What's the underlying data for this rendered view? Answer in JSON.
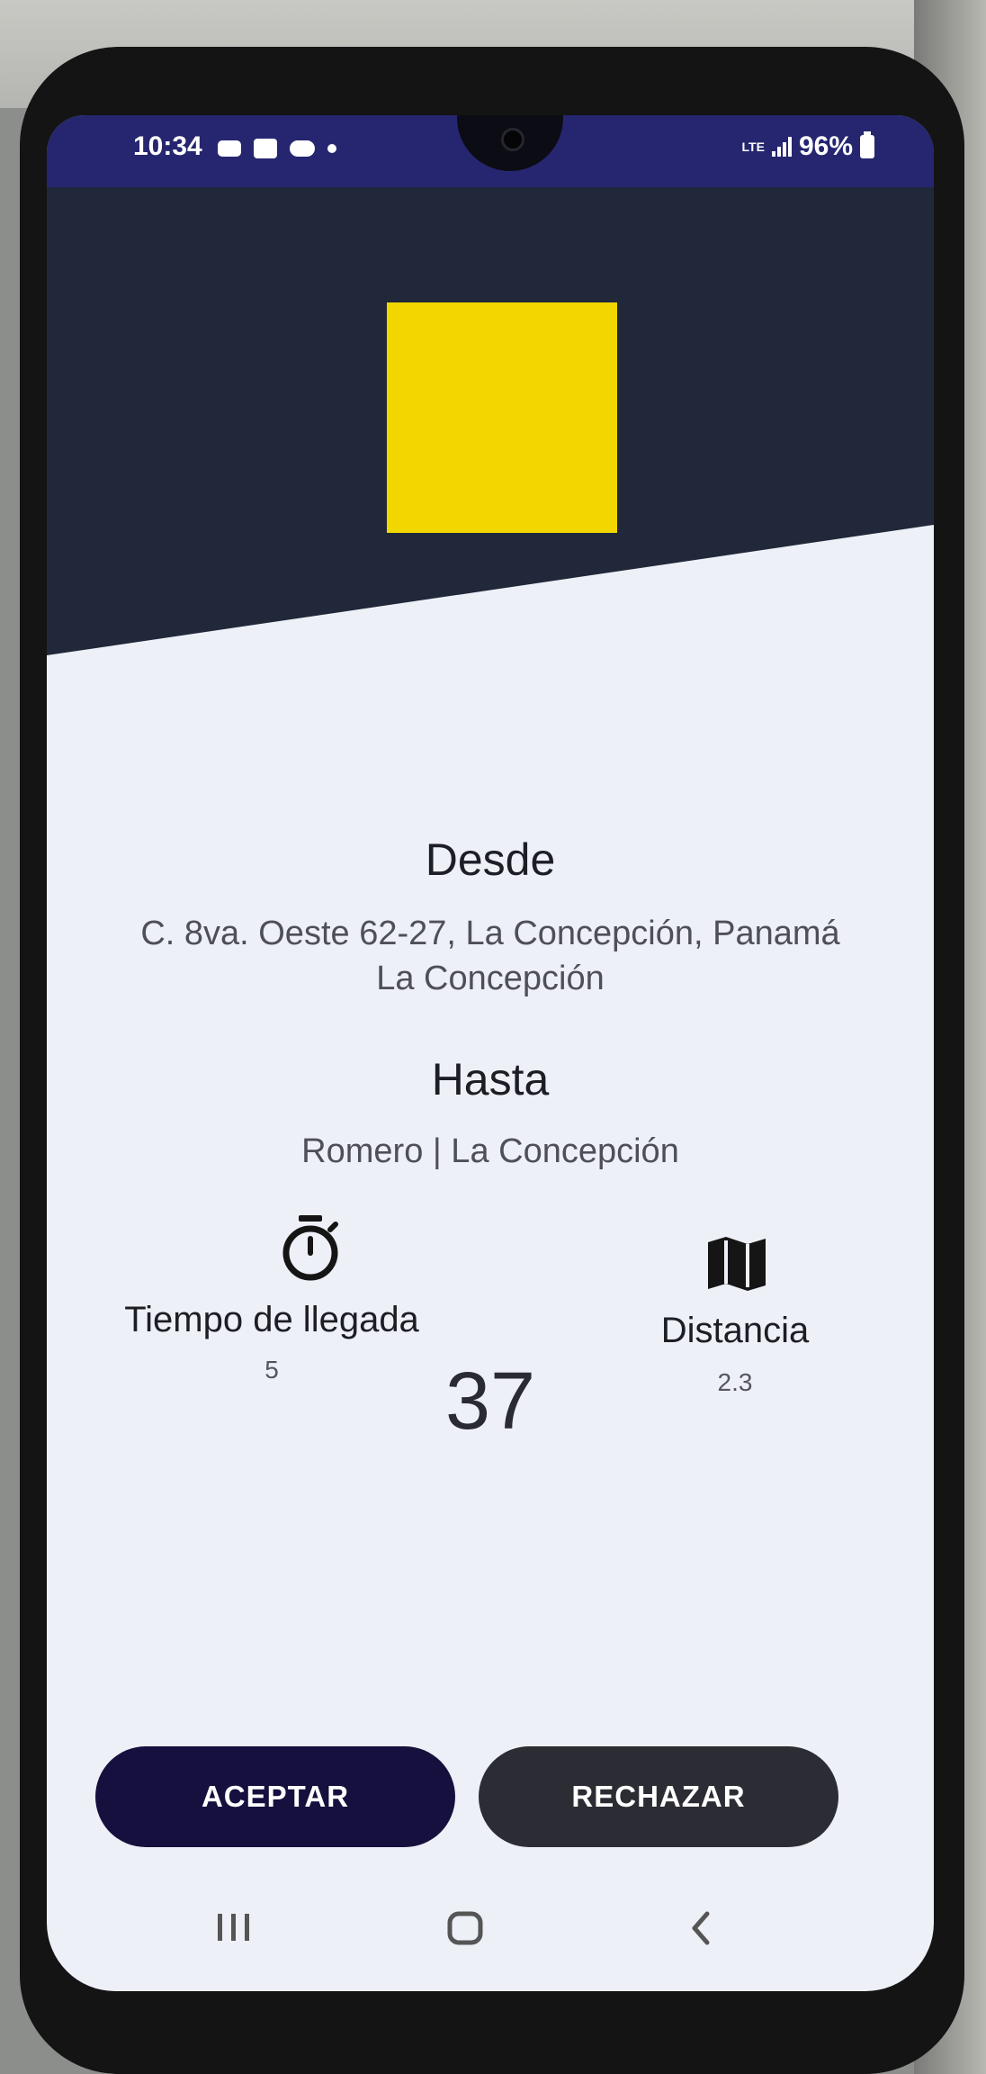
{
  "status_bar": {
    "time": "10:34",
    "network": "LTE",
    "battery": "96%",
    "notification_icons": [
      "car-icon",
      "message-icon",
      "cloud-icon",
      "dot-icon"
    ],
    "background_color": "#262670"
  },
  "header": {
    "logo_color": "#f2d600",
    "background_color": "#20283a"
  },
  "origin": {
    "title": "Desde",
    "address_line1": "C. 8va. Oeste 62-27, La Concepción, Panamá",
    "address_line2": "La Concepción"
  },
  "destination": {
    "title": "Hasta",
    "address": "Romero | La Concepción"
  },
  "stats": {
    "arrival_time": {
      "label": "Tiempo de llegada",
      "value": "5",
      "icon": "stopwatch-icon"
    },
    "distance": {
      "label": "Distancia",
      "value": "2.3",
      "icon": "map-icon"
    }
  },
  "counter": "37",
  "actions": {
    "accept_label": "ACEPTAR",
    "accept_color": "#15103e",
    "reject_label": "RECHAZAR",
    "reject_color": "#2c2d34"
  },
  "navigation_bar": [
    "recent-apps-icon",
    "home-icon",
    "back-icon"
  ]
}
